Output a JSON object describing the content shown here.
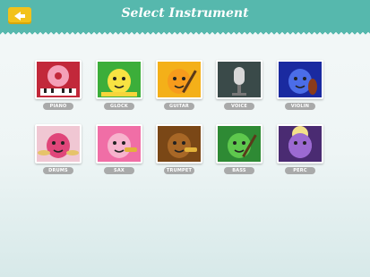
{
  "header": {
    "title": "Select Instrument",
    "back_icon": "back-arrow-icon",
    "accent": "#56b8ad",
    "back_color": "#f2c21b"
  },
  "instruments": [
    {
      "label": "PIANO",
      "icon": "donut-piano-character",
      "bg": "#c2283a",
      "face": "#f4a0b8"
    },
    {
      "label": "GLOCK",
      "icon": "glock-character",
      "bg": "#3cae3a",
      "face": "#f8e342"
    },
    {
      "label": "GUITAR",
      "icon": "guitar-character",
      "bg": "#f4b019",
      "face": "#f79b1c"
    },
    {
      "label": "VOICE",
      "icon": "microphone",
      "bg": "#3a4a49",
      "face": "#d8d8d8"
    },
    {
      "label": "VIOLIN",
      "icon": "violin-character",
      "bg": "#1a2aa0",
      "face": "#4b6de8"
    },
    {
      "label": "DRUMS",
      "icon": "drums-character",
      "bg": "#f0c7d3",
      "face": "#e0467a"
    },
    {
      "label": "SAX",
      "icon": "sax-character",
      "bg": "#f06ea6",
      "face": "#f7b3cd"
    },
    {
      "label": "TRUMPET",
      "icon": "trumpet-character",
      "bg": "#7a4716",
      "face": "#a86726"
    },
    {
      "label": "BASS",
      "icon": "bass-character",
      "bg": "#2e8a34",
      "face": "#5ec84d"
    },
    {
      "label": "PERC",
      "icon": "percussion-character",
      "bg": "#4a2b72",
      "face": "#9c6ad2"
    }
  ]
}
